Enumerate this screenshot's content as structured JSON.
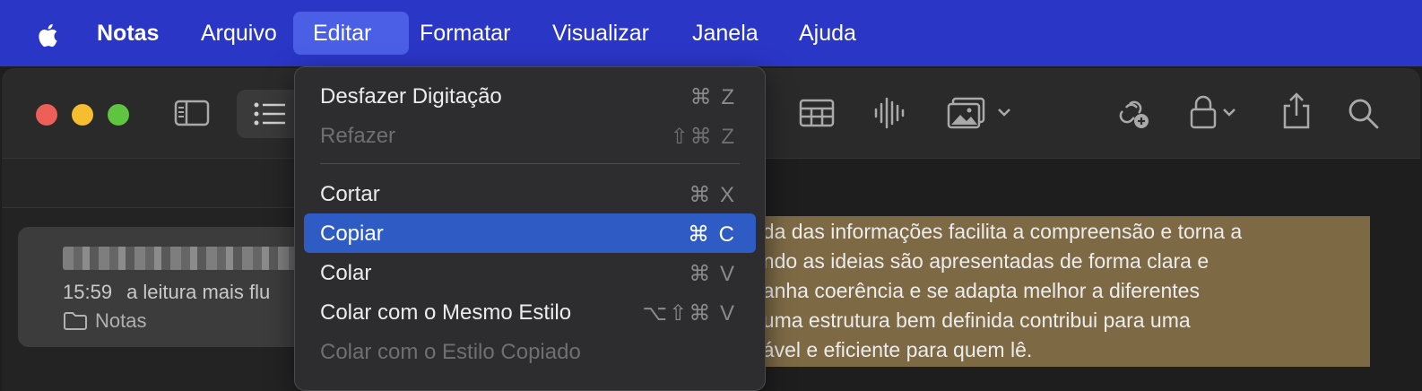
{
  "menubar": {
    "app_name": "Notas",
    "items": [
      "Arquivo",
      "Editar",
      "Formatar",
      "Visualizar",
      "Janela",
      "Ajuda"
    ],
    "active_item": "Editar",
    "background_color": "#2a36c6"
  },
  "edit_menu": {
    "items": [
      {
        "label": "Desfazer Digitação",
        "shortcut": "⌘ Z",
        "state": "enabled"
      },
      {
        "label": "Refazer",
        "shortcut": "⇧⌘ Z",
        "state": "disabled"
      },
      {
        "label": "Cortar",
        "shortcut": "⌘ X",
        "state": "enabled"
      },
      {
        "label": "Copiar",
        "shortcut": "⌘ C",
        "state": "selected"
      },
      {
        "label": "Colar",
        "shortcut": "⌘ V",
        "state": "enabled"
      },
      {
        "label": "Colar com o Mesmo Estilo",
        "shortcut": "⌥⇧⌘ V",
        "state": "enabled"
      },
      {
        "label": "Colar com o Estilo Copiado",
        "shortcut": "",
        "state": "disabled"
      }
    ]
  },
  "toolbar": {
    "icons": [
      "sidebar-toggle-icon",
      "list-view-icon",
      "table-icon",
      "audio-waveform-icon",
      "media-icon",
      "collaborate-icon",
      "lock-icon",
      "share-icon",
      "search-icon"
    ]
  },
  "sidebar": {
    "note": {
      "time": "15:59",
      "preview": "a leitura mais flu",
      "folder": "Notas"
    }
  },
  "editor": {
    "highlight_color": "#7d6a45",
    "lines": [
      "ada das informações facilita a compreensão e torna a",
      "ando as ideias são apresentadas de forma clara e",
      "ganha coerência e se adapta melhor a diferentes",
      ", uma estrutura bem definida contribui para uma",
      "dável e eficiente para quem lê."
    ]
  }
}
